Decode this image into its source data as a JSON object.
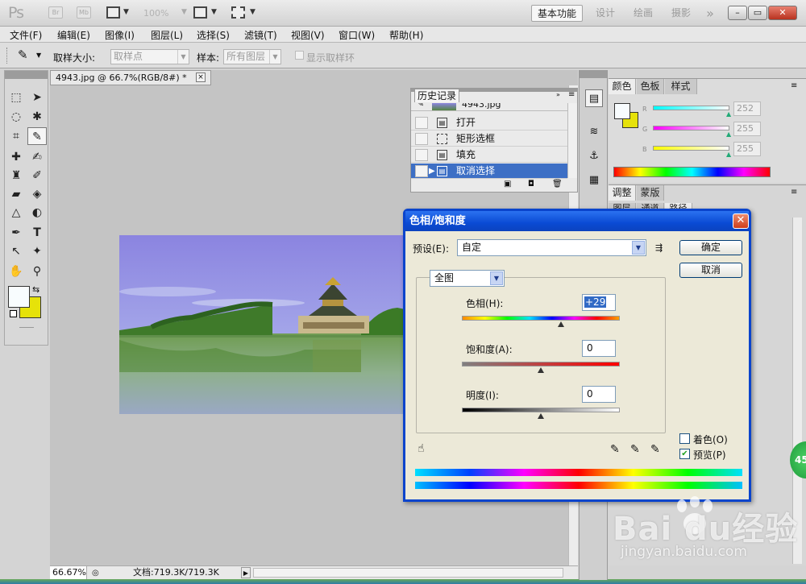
{
  "app": {
    "logo": "Ps",
    "bridge_label": "Br",
    "minibridge_label": "Mb",
    "zoom": "100%",
    "workspaces": [
      "基本功能",
      "设计",
      "绘画",
      "摄影"
    ],
    "more": "»",
    "window_controls": {
      "minimize": "–",
      "restore": "▭",
      "close": "✕"
    }
  },
  "menu": [
    "文件(F)",
    "编辑(E)",
    "图像(I)",
    "图层(L)",
    "选择(S)",
    "滤镜(T)",
    "视图(V)",
    "窗口(W)",
    "帮助(H)"
  ],
  "options": {
    "sample_size_label": "取样大小:",
    "sample_size_value": "取样点",
    "sample_label": "样本:",
    "sample_value": "所有图层",
    "show_ring": "显示取样环"
  },
  "document": {
    "tab_title": "4943.jpg @ 66.7%(RGB/8#) *",
    "close": "×",
    "zoom": "66.67%",
    "doc_size": "文档:719.3K/719.3K"
  },
  "history": {
    "tab": "历史记录",
    "snapshot": "4943.jpg",
    "items": [
      "打开",
      "矩形选框",
      "填充",
      "取消选择"
    ],
    "selected_index": 3
  },
  "color_panel": {
    "tabs": [
      "颜色",
      "色板",
      "样式"
    ],
    "channels": [
      {
        "name": "R",
        "value": "252"
      },
      {
        "name": "G",
        "value": "255"
      },
      {
        "name": "B",
        "value": "255"
      }
    ]
  },
  "adjust_panel": {
    "tabs": [
      "调整",
      "蒙版"
    ],
    "sub_tabs": [
      "图层",
      "通道",
      "路径"
    ]
  },
  "dialog": {
    "title": "色相/饱和度",
    "preset_label": "预设(E):",
    "preset_value": "自定",
    "ok": "确定",
    "cancel": "取消",
    "channel": "全图",
    "hue_label": "色相(H):",
    "hue_value": "+29",
    "hue_level": 0.625,
    "saturation_label": "饱和度(A):",
    "saturation_value": "0",
    "saturation_level": 0.5,
    "lightness_label": "明度(I):",
    "lightness_value": "0",
    "lightness_level": 0.5,
    "colorize_label": "着色(O)",
    "preview_label": "预览(P)",
    "preview_checked": true
  },
  "overlays": {
    "badge": "45",
    "watermark_main": "Bai  du经验",
    "watermark_sub": "jingyan.baidu.com"
  },
  "colors": {
    "foreground": "#f8fcfe",
    "background": "#e6e20a",
    "selection": "#3d6fc5",
    "dialog_title": "#0a4ad4"
  }
}
